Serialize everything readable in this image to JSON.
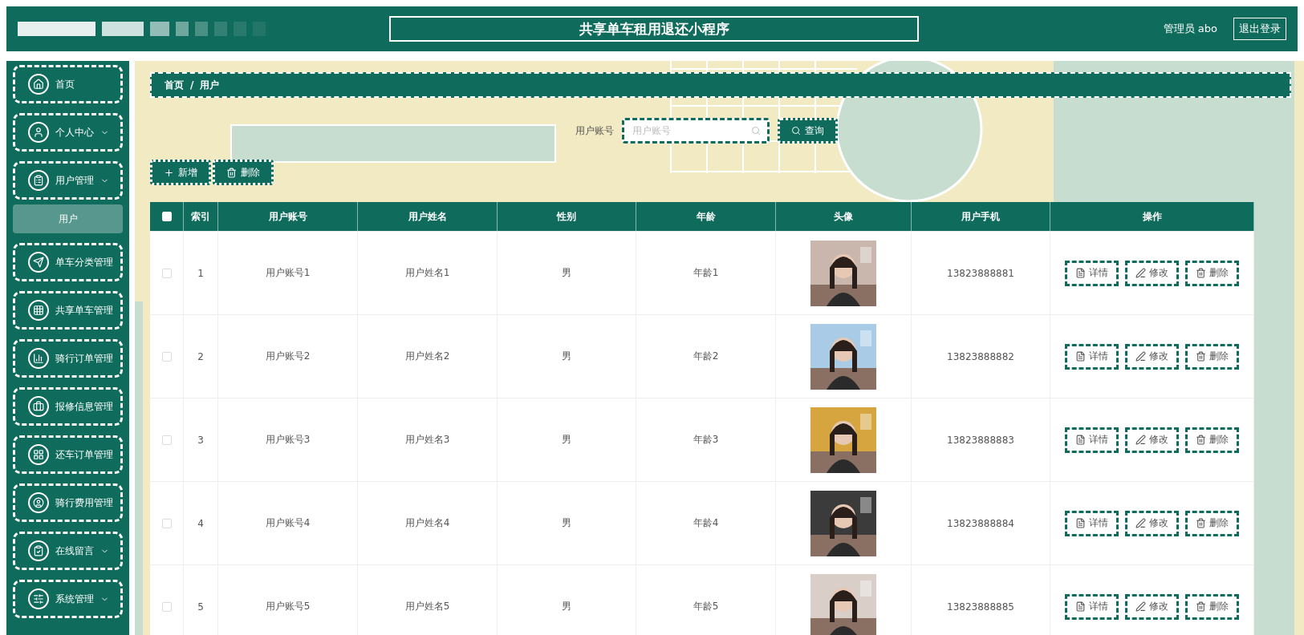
{
  "header": {
    "title": "共享单车租用退还小程序",
    "user": "管理员 abo",
    "logout": "退出登录"
  },
  "sidebar": {
    "items": [
      {
        "label": "首页",
        "expandable": false
      },
      {
        "label": "个人中心",
        "expandable": true
      },
      {
        "label": "用户管理",
        "expandable": true,
        "children": [
          {
            "label": "用户",
            "selected": true
          }
        ]
      },
      {
        "label": "单车分类管理",
        "expandable": false
      },
      {
        "label": "共享单车管理",
        "expandable": false
      },
      {
        "label": "骑行订单管理",
        "expandable": false
      },
      {
        "label": "报修信息管理",
        "expandable": false
      },
      {
        "label": "还车订单管理",
        "expandable": false
      },
      {
        "label": "骑行费用管理",
        "expandable": false
      },
      {
        "label": "在线留言",
        "expandable": true
      },
      {
        "label": "系统管理",
        "expandable": true
      }
    ]
  },
  "breadcrumb": [
    "首页",
    "/",
    "用户"
  ],
  "search": {
    "label": "用户账号",
    "placeholder": "用户账号",
    "button": "查询"
  },
  "actions": [
    {
      "kind": "add",
      "label": "新增"
    },
    {
      "kind": "delete",
      "label": "删除"
    }
  ],
  "table": {
    "select_all": {
      "checked": false
    },
    "columns": [
      "索引",
      "用户账号",
      "用户姓名",
      "性别",
      "年龄",
      "头像",
      "用户手机",
      "操作"
    ],
    "rows": [
      {
        "checked": false,
        "index": "1",
        "account": "用户账号1",
        "name": "用户姓名1",
        "gender": "男",
        "age": "年龄1",
        "phone": "13823888881",
        "actions": [
          {
            "kind": "detail",
            "label": "详情"
          },
          {
            "kind": "edit",
            "label": "修改"
          },
          {
            "kind": "delete",
            "label": "删除"
          }
        ]
      },
      {
        "checked": false,
        "index": "2",
        "account": "用户账号2",
        "name": "用户姓名2",
        "gender": "男",
        "age": "年龄2",
        "phone": "13823888882",
        "actions": [
          {
            "kind": "detail",
            "label": "详情"
          },
          {
            "kind": "edit",
            "label": "修改"
          },
          {
            "kind": "delete",
            "label": "删除"
          }
        ]
      },
      {
        "checked": false,
        "index": "3",
        "account": "用户账号3",
        "name": "用户姓名3",
        "gender": "男",
        "age": "年龄3",
        "phone": "13823888883",
        "actions": [
          {
            "kind": "detail",
            "label": "详情"
          },
          {
            "kind": "edit",
            "label": "修改"
          },
          {
            "kind": "delete",
            "label": "删除"
          }
        ]
      },
      {
        "checked": false,
        "index": "4",
        "account": "用户账号4",
        "name": "用户姓名4",
        "gender": "男",
        "age": "年龄4",
        "phone": "13823888884",
        "actions": [
          {
            "kind": "detail",
            "label": "详情"
          },
          {
            "kind": "edit",
            "label": "修改"
          },
          {
            "kind": "delete",
            "label": "删除"
          }
        ]
      },
      {
        "checked": false,
        "index": "5",
        "account": "用户账号5",
        "name": "用户姓名5",
        "gender": "男",
        "age": "年龄5",
        "phone": "13823888885",
        "actions": [
          {
            "kind": "detail",
            "label": "详情"
          },
          {
            "kind": "edit",
            "label": "修改"
          },
          {
            "kind": "delete",
            "label": "删除"
          }
        ]
      }
    ]
  }
}
